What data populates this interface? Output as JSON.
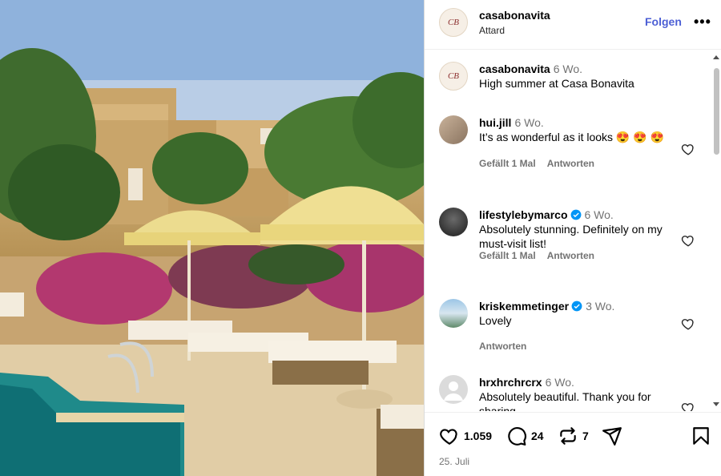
{
  "post": {
    "username": "casabonavita",
    "location": "Attard",
    "follow_label": "Folgen",
    "more_label": "•••",
    "avatar_monogram": "CB"
  },
  "caption": {
    "username": "casabonavita",
    "time": "6 Wo.",
    "text": "High summer at Casa Bonavita"
  },
  "comments": [
    {
      "username": "hui.jill",
      "time": "6 Wo.",
      "text": "It’s as wonderful as it looks 😍 😍 😍",
      "likes": "Gefällt 1 Mal",
      "reply": "Antworten",
      "verified": false
    },
    {
      "username": "lifestylebymarco",
      "time": "6 Wo.",
      "text": "Absolutely stunning. Definitely on my must-visit list!",
      "likes": "Gefällt 1 Mal",
      "reply": "Antworten",
      "verified": true
    },
    {
      "username": "kriskemmetinger",
      "time": "3 Wo.",
      "text": "Lovely",
      "likes": "",
      "reply": "Antworten",
      "verified": true
    },
    {
      "username": "hrxhrchrcrx",
      "time": "6 Wo.",
      "text": "Absolutely beautiful. Thank you for sharing",
      "likes": "",
      "reply": "",
      "verified": false
    }
  ],
  "actions": {
    "like_count": "1.059",
    "comment_count": "24",
    "repost_count": "7"
  },
  "date": "25. Juli",
  "icons": {
    "like": "heart-icon",
    "comment": "comment-icon",
    "repost": "repost-icon",
    "share": "share-icon",
    "save": "bookmark-icon",
    "verified": "verified-badge-icon"
  },
  "colors": {
    "follow": "#4c5fd5",
    "verified": "#0095f6",
    "meta": "#737373",
    "heart_emoji": "#e0245e"
  }
}
